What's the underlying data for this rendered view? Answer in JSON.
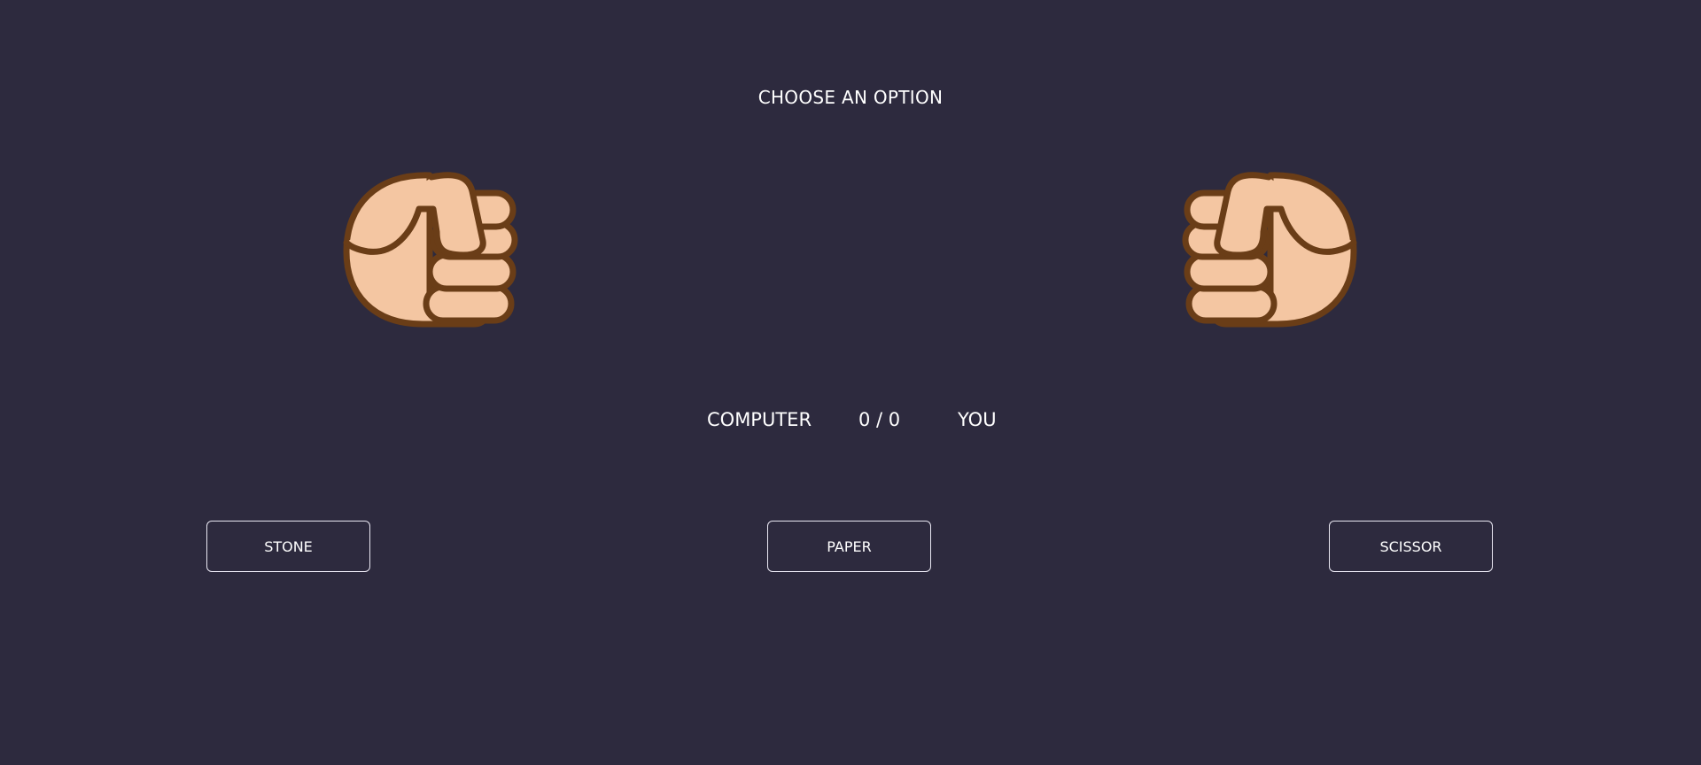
{
  "game": {
    "title": "CHOOSE AN OPTION",
    "hands": {
      "computer_icon": "fist-icon",
      "you_icon": "fist-icon"
    },
    "scoreboard": {
      "computer_label": "COMPUTER",
      "score": "0 / 0",
      "you_label": "YOU"
    },
    "options": {
      "stone_label": "STONE",
      "paper_label": "PAPER",
      "scissor_label": "SCISSOR"
    }
  },
  "colors": {
    "background": "#2d2a3e",
    "text": "#ffffff",
    "button_border": "#e9e7f2",
    "skin": "#f4c6a2",
    "outline": "#6a3d17"
  }
}
